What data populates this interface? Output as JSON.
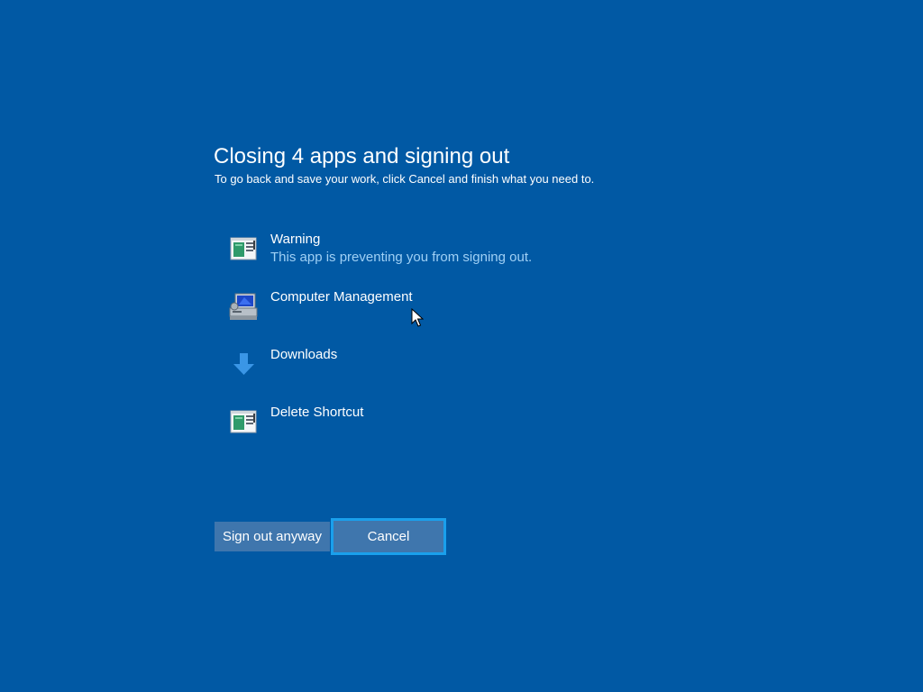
{
  "dialog": {
    "title": "Closing 4 apps and signing out",
    "subtitle": "To go back and save your work, click Cancel and finish what you need to."
  },
  "apps": [
    {
      "name": "Warning",
      "status": "This app is preventing you from signing out.",
      "icon": "app-window-icon"
    },
    {
      "name": "Computer Management",
      "status": "",
      "icon": "computer-management-icon"
    },
    {
      "name": "Downloads",
      "status": "",
      "icon": "download-arrow-icon"
    },
    {
      "name": "Delete Shortcut",
      "status": "",
      "icon": "app-window-icon"
    }
  ],
  "buttons": {
    "sign_out_anyway": "Sign out anyway",
    "cancel": "Cancel"
  },
  "colors": {
    "background": "#0159a4",
    "button": "#3f76ad",
    "focus_border": "#1aa0ec",
    "status_text": "#9fd0f5"
  }
}
